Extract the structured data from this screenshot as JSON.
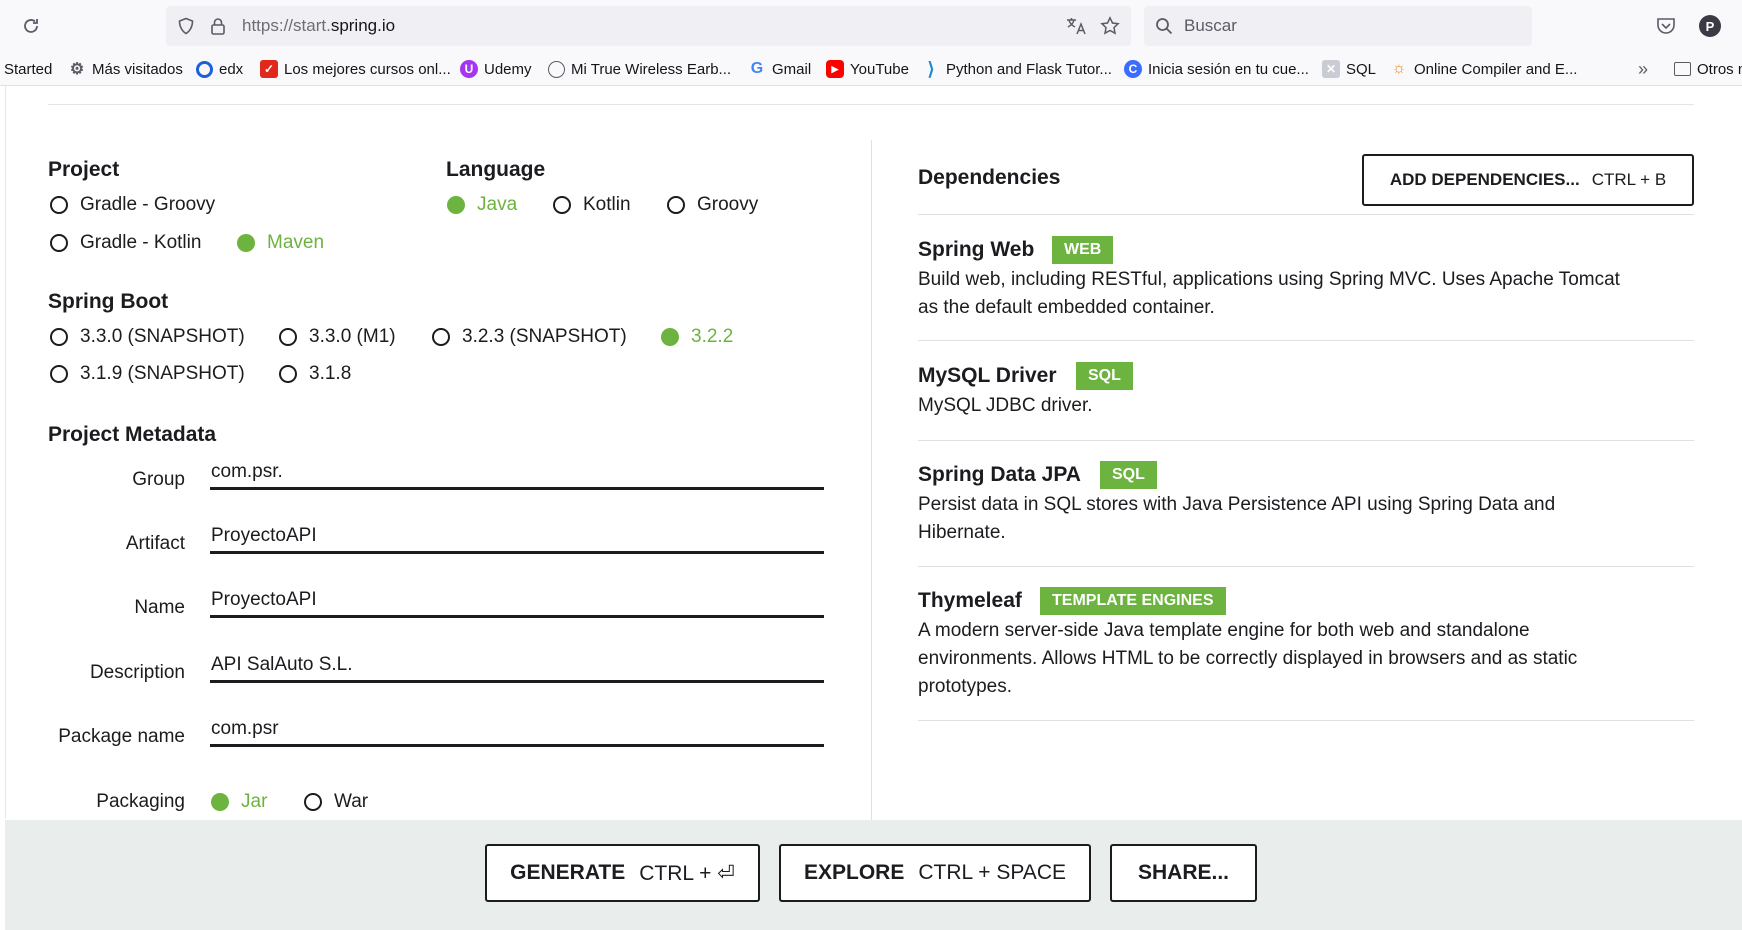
{
  "browser": {
    "url_prefix": "https://start.",
    "url_domain": "spring.io",
    "search_placeholder": "Buscar",
    "profile_initial": "P"
  },
  "bookmarks": [
    {
      "label": "Started"
    },
    {
      "label": "Más visitados"
    },
    {
      "label": "edx"
    },
    {
      "label": "Los mejores cursos onl..."
    },
    {
      "label": "Udemy"
    },
    {
      "label": "Mi True Wireless Earb..."
    },
    {
      "label": "Gmail"
    },
    {
      "label": "YouTube"
    },
    {
      "label": "Python and Flask Tutor..."
    },
    {
      "label": "Inicia sesión en tu cue..."
    },
    {
      "label": "SQL"
    },
    {
      "label": "Online Compiler and E..."
    },
    {
      "label": "Otros m"
    }
  ],
  "project": {
    "title": "Project",
    "options": [
      "Gradle - Groovy",
      "Gradle - Kotlin",
      "Maven"
    ],
    "selected": "Maven"
  },
  "language": {
    "title": "Language",
    "options": [
      "Java",
      "Kotlin",
      "Groovy"
    ],
    "selected": "Java"
  },
  "spring_boot": {
    "title": "Spring Boot",
    "options": [
      "3.3.0 (SNAPSHOT)",
      "3.3.0 (M1)",
      "3.2.3 (SNAPSHOT)",
      "3.2.2",
      "3.1.9 (SNAPSHOT)",
      "3.1.8"
    ],
    "selected": "3.2.2"
  },
  "metadata": {
    "title": "Project Metadata",
    "fields": [
      {
        "label": "Group",
        "value": "com.psr."
      },
      {
        "label": "Artifact",
        "value": "ProyectoAPI"
      },
      {
        "label": "Name",
        "value": "ProyectoAPI"
      },
      {
        "label": "Description",
        "value": "API SalAuto S.L."
      },
      {
        "label": "Package name",
        "value": "com.psr"
      }
    ],
    "packaging_label": "Packaging",
    "packaging_options": [
      "Jar",
      "War"
    ],
    "packaging_selected": "Jar"
  },
  "dependencies": {
    "title": "Dependencies",
    "add_label": "ADD DEPENDENCIES...",
    "add_shortcut": "CTRL + B",
    "items": [
      {
        "name": "Spring Web",
        "tag": "WEB",
        "description": "Build web, including RESTful, applications using Spring MVC. Uses Apache Tomcat as the default embedded container."
      },
      {
        "name": "MySQL Driver",
        "tag": "SQL",
        "description": "MySQL JDBC driver."
      },
      {
        "name": "Spring Data JPA",
        "tag": "SQL",
        "description": "Persist data in SQL stores with Java Persistence API using Spring Data and Hibernate."
      },
      {
        "name": "Thymeleaf",
        "tag": "TEMPLATE ENGINES",
        "description": "A modern server-side Java template engine for both web and standalone environments. Allows HTML to be correctly displayed in browsers and as static prototypes."
      }
    ]
  },
  "footer": {
    "generate_label": "GENERATE",
    "generate_shortcut": "CTRL + ⏎",
    "explore_label": "EXPLORE",
    "explore_shortcut": "CTRL + SPACE",
    "share_label": "SHARE..."
  },
  "colors": {
    "accent": "#6db33f",
    "text": "#1c1b1f",
    "footer_bg": "#e9eeed"
  }
}
